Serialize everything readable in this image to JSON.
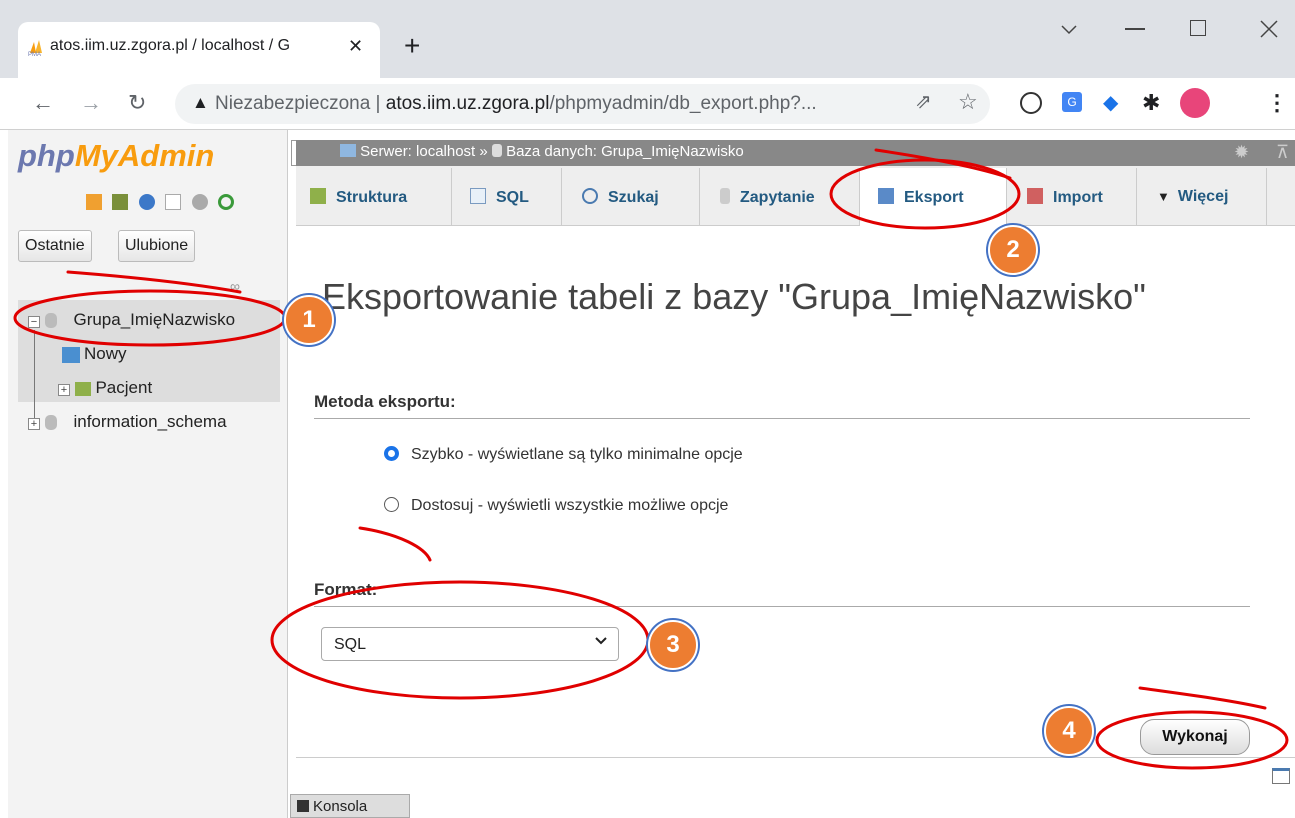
{
  "browser": {
    "tab_title": "atos.iim.uz.zgora.pl / localhost / G",
    "tab_close": "✕",
    "new_tab": "+",
    "security_label": "Niezabezpieczona",
    "url_host": "atos.iim.uz.zgora.pl",
    "url_path": "/phpmyadmin/db_export.php?...",
    "window_controls": [
      "minimize",
      "maximize",
      "close"
    ]
  },
  "sidebar": {
    "logo_php": "php",
    "logo_myadmin": "MyAdmin",
    "recent_btn": "Ostatnie",
    "favorites_btn": "Ulubione",
    "tree": [
      {
        "label": "Grupa_ImięNazwisko",
        "level": 0,
        "expanded": true
      },
      {
        "label": "Nowy",
        "level": 1
      },
      {
        "label": "Pacjent",
        "level": 1
      },
      {
        "label": "information_schema",
        "level": 0
      }
    ]
  },
  "main": {
    "breadcrumb_server": "Serwer: localhost »",
    "breadcrumb_db": "Baza danych: Grupa_ImięNazwisko",
    "tabs": [
      {
        "label": "Struktura",
        "icon": "structure-icon"
      },
      {
        "label": "SQL",
        "icon": "sql-icon"
      },
      {
        "label": "Szukaj",
        "icon": "search-icon"
      },
      {
        "label": "Zapytanie",
        "icon": "query-icon"
      },
      {
        "label": "Eksport",
        "icon": "export-icon",
        "active": true
      },
      {
        "label": "Import",
        "icon": "import-icon"
      },
      {
        "label": "Więcej",
        "icon": "chevron-down-icon"
      }
    ],
    "heading": "Eksportowanie tabeli z bazy \"Grupa_ImięNazwisko\"",
    "method_label": "Metoda eksportu:",
    "method_quick": "Szybko - wyświetlane są tylko minimalne opcje",
    "method_custom": "Dostosuj - wyświetli wszystkie możliwe opcje",
    "format_label": "Format:",
    "format_value": "SQL",
    "go_button": "Wykonaj",
    "console": "Konsola"
  },
  "annotations": [
    "1",
    "2",
    "3",
    "4"
  ],
  "colors": {
    "accent": "#235a81",
    "logo_blue": "#6c78af",
    "logo_orange": "#f89c0e",
    "badge": "#ed7d31",
    "annotation_line": "#e00000",
    "radio_selected": "#1a73e8"
  }
}
